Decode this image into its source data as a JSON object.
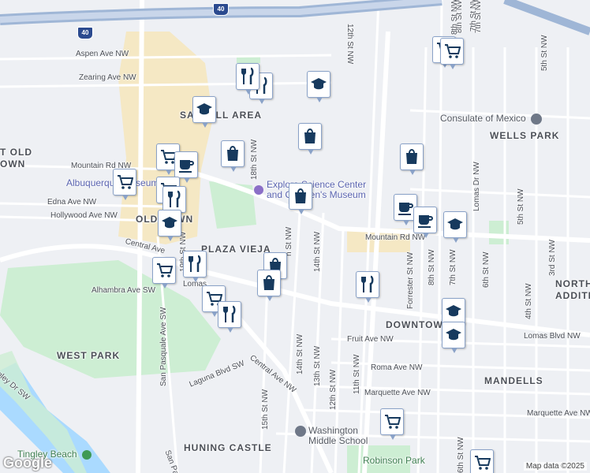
{
  "map": {
    "streets": [
      "Aspen Ave NW",
      "Zearing Ave NW",
      "Mountain Rd NW",
      "Edna Ave NW",
      "Hollywood Ave NW",
      "Central Ave",
      "Alhambra Ave SW",
      "Lomas",
      "Mountain Rd NW",
      "Fruit Ave NW",
      "Roma Ave NW",
      "Marquette Ave NW",
      "Marquette Ave NW",
      "Laguna Blvd SW",
      "Central Ave NW",
      "Lomas Blvd NW",
      "12th St NW",
      "8th St NW",
      "7th St NW",
      "18th St NW",
      "19th St NW",
      "San Pasquale Ave SW",
      "14th St NW",
      "14th St NW",
      "13th St NW",
      "12th St NW",
      "11th St NW",
      "15th St NW",
      "Forrester St NW",
      "8th St NW",
      "7th St NW",
      "Lomas Dr NW",
      "6th St NW",
      "5th St NW",
      "4th St NW",
      "3rd St NW",
      "6th St NW",
      "5th St NW",
      "gley Dr SW",
      "San Pat",
      "h St NW",
      "8th St NW",
      "7th St NW"
    ],
    "neighborhoods": [
      "SAWMILL AREA",
      "WELLS PARK",
      "T OLD\nOWN",
      "OLD TOWN",
      "PLAZA VIEJA",
      "DOWNTOWN",
      "WEST PARK",
      "MANDELLS",
      "HUNING CASTLE",
      "NORTH\nADDITI"
    ],
    "pois": {
      "explora": "Explora Science Center\nand Children's Museum",
      "albuquerque_museum": "Albuquerque Museum",
      "consulate": "Consulate of Mexico",
      "washington": "Washington\nMiddle School",
      "robinson": "Robinson Park",
      "tingley": "Tingley Beach"
    },
    "highway_shields": [
      "40",
      "40"
    ],
    "markers": [
      {
        "type": "grocery"
      },
      {
        "type": "grocery"
      },
      {
        "type": "restaurant"
      },
      {
        "type": "restaurant"
      },
      {
        "type": "school"
      },
      {
        "type": "school"
      },
      {
        "type": "shopping"
      },
      {
        "type": "shopping"
      },
      {
        "type": "grocery"
      },
      {
        "type": "cafe"
      },
      {
        "type": "grocery"
      },
      {
        "type": "shopping"
      },
      {
        "type": "grocery"
      },
      {
        "type": "restaurant"
      },
      {
        "type": "school"
      },
      {
        "type": "shopping"
      },
      {
        "type": "cafe"
      },
      {
        "type": "cafe"
      },
      {
        "type": "school"
      },
      {
        "type": "grocery"
      },
      {
        "type": "restaurant"
      },
      {
        "type": "shopping"
      },
      {
        "type": "shopping"
      },
      {
        "type": "restaurant"
      },
      {
        "type": "grocery"
      },
      {
        "type": "restaurant"
      },
      {
        "type": "school"
      },
      {
        "type": "school"
      },
      {
        "type": "grocery"
      },
      {
        "type": "grocery"
      }
    ]
  },
  "footer": {
    "attribution": "Map data ©2025",
    "logo": "Google"
  },
  "colors": {
    "pin_fill": "#ffffff",
    "pin_border": "#8aa2c8",
    "icon": "#173a5e",
    "park": "#cdeed3",
    "water": "#aadaff",
    "urban": "#f7e7b8"
  }
}
